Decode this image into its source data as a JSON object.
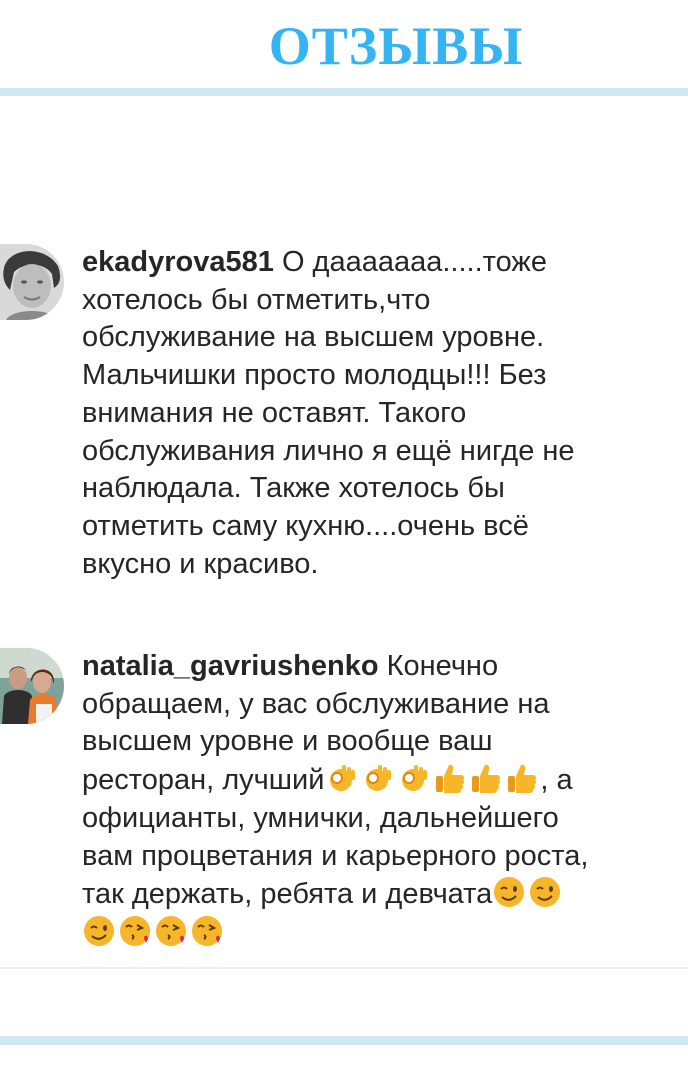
{
  "page": {
    "title": "ОТЗЫВЫ"
  },
  "comments": [
    {
      "username": "ekadyrova581",
      "lines": [
        "О дааааааа.....тоже",
        "хотелось бы отметить,что",
        "обслуживание на высшем уровне.",
        "Мальчишки просто молодцы!!! Без",
        "внимания не оставят. Такого",
        "обслуживания лично я ещё нигде не",
        "наблюдала. Также хотелось бы",
        "отметить саму кухню....очень всё",
        "вкусно и красиво."
      ]
    },
    {
      "username": "natalia_gavriushenko",
      "line1_text": "Конечно",
      "line2": "обращаем, у вас обслуживание на",
      "line3": "высшем уровне и вообще ваш",
      "line4_prefix": "ресторан, лучший",
      "line4_suffix": ", а",
      "line5": "официанты, умнички, дальнейшего",
      "line6": "вам процветания и карьерного роста,",
      "line7_text": "так держать, ребята и девчата",
      "emojis": {
        "line4": [
          "ok-hand",
          "ok-hand",
          "ok-hand",
          "thumbs-up",
          "thumbs-up",
          "thumbs-up"
        ],
        "line7": [
          "wink",
          "wink"
        ],
        "line8": [
          "wink",
          "kiss",
          "kiss",
          "kiss"
        ]
      }
    }
  ],
  "colors": {
    "title": "#34b4f3",
    "rule": "#cfe9f2",
    "text": "#262626",
    "emoji_yellow": "#f7b52a"
  }
}
